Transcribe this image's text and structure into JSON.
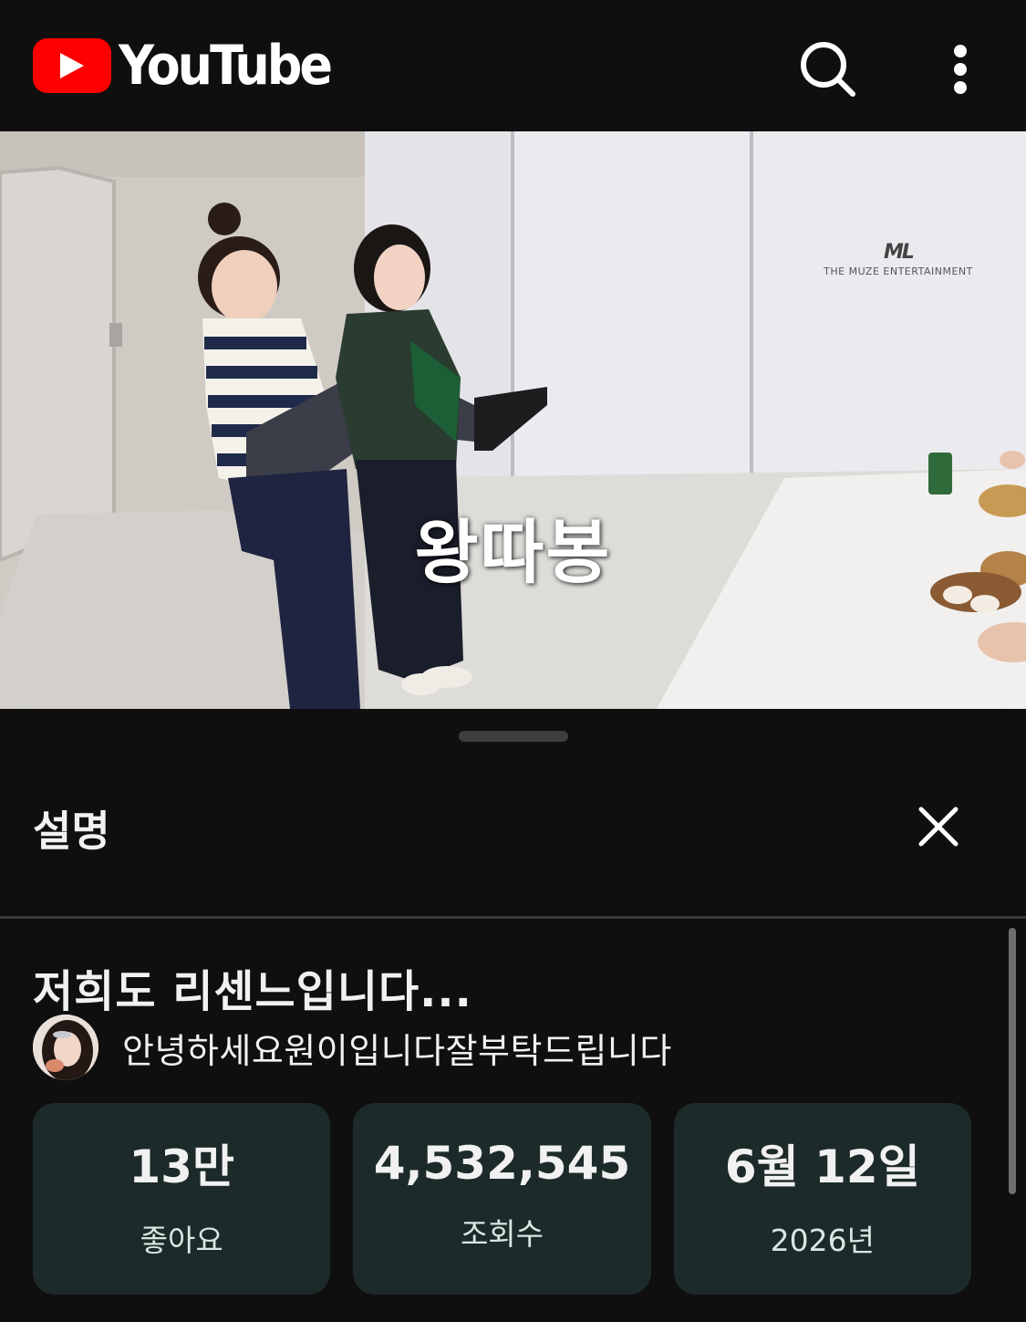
{
  "app": {
    "brand": "YouTube",
    "brand_color": "#ff0000"
  },
  "topbar": {
    "icons": [
      "youtube-logo-icon",
      "search-icon",
      "more-vert-icon"
    ]
  },
  "video": {
    "caption": "왕따봉",
    "wall_sign_mark": "ML",
    "wall_sign_text": "THE MUZE ENTERTAINMENT"
  },
  "sheet": {
    "title": "설명",
    "close_icon": "close-icon",
    "video_title": "저희도 리센느입니다...",
    "channel_name": "안녕하세요원이입니다잘부탁드립니다",
    "stats": [
      {
        "value": "13만",
        "label": "좋아요"
      },
      {
        "value": "4,532,545",
        "label": "조회수"
      },
      {
        "value": "6월 12일",
        "label": "2026년"
      }
    ],
    "stat_card_color": "#1c2b29"
  }
}
